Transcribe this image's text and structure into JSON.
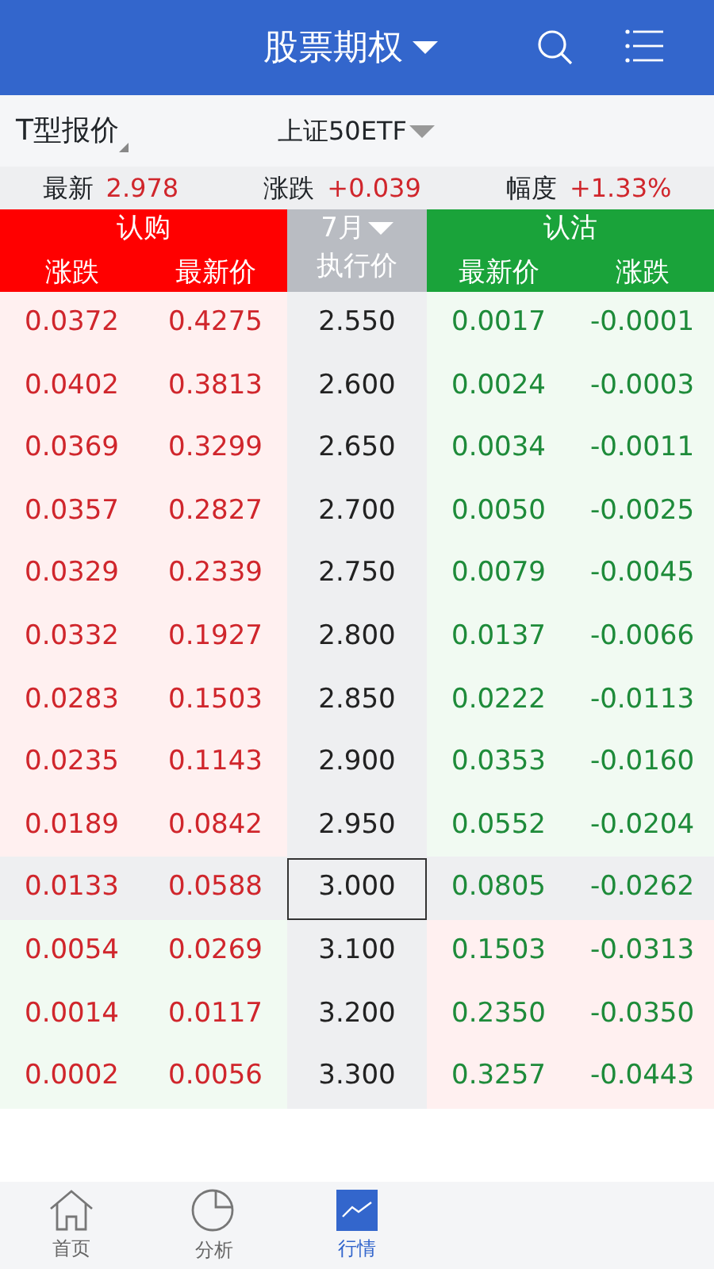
{
  "header": {
    "title": "股票期权"
  },
  "subheader": {
    "view": "T型报价",
    "underlying": "上证50ETF"
  },
  "quote": [
    {
      "label": "最新",
      "value": "2.978"
    },
    {
      "label": "涨跌",
      "value": "+0.039"
    },
    {
      "label": "幅度",
      "value": "+1.33%"
    }
  ],
  "table": {
    "call_title": "认购",
    "put_title": "认沽",
    "month": "7月",
    "call_columns": [
      "涨跌",
      "最新价"
    ],
    "strike_column": "执行价",
    "put_columns": [
      "最新价",
      "涨跌"
    ],
    "rows": [
      {
        "kind": "call_itm",
        "selected": false,
        "call_change": "0.0372",
        "call_price": "0.4275",
        "strike": "2.550",
        "put_price": "0.0017",
        "put_change": "-0.0001"
      },
      {
        "kind": "call_itm",
        "selected": false,
        "call_change": "0.0402",
        "call_price": "0.3813",
        "strike": "2.600",
        "put_price": "0.0024",
        "put_change": "-0.0003"
      },
      {
        "kind": "call_itm",
        "selected": false,
        "call_change": "0.0369",
        "call_price": "0.3299",
        "strike": "2.650",
        "put_price": "0.0034",
        "put_change": "-0.0011"
      },
      {
        "kind": "call_itm",
        "selected": false,
        "call_change": "0.0357",
        "call_price": "0.2827",
        "strike": "2.700",
        "put_price": "0.0050",
        "put_change": "-0.0025"
      },
      {
        "kind": "call_itm",
        "selected": false,
        "call_change": "0.0329",
        "call_price": "0.2339",
        "strike": "2.750",
        "put_price": "0.0079",
        "put_change": "-0.0045"
      },
      {
        "kind": "call_itm",
        "selected": false,
        "call_change": "0.0332",
        "call_price": "0.1927",
        "strike": "2.800",
        "put_price": "0.0137",
        "put_change": "-0.0066"
      },
      {
        "kind": "call_itm",
        "selected": false,
        "call_change": "0.0283",
        "call_price": "0.1503",
        "strike": "2.850",
        "put_price": "0.0222",
        "put_change": "-0.0113"
      },
      {
        "kind": "call_itm",
        "selected": false,
        "call_change": "0.0235",
        "call_price": "0.1143",
        "strike": "2.900",
        "put_price": "0.0353",
        "put_change": "-0.0160"
      },
      {
        "kind": "call_itm",
        "selected": false,
        "call_change": "0.0189",
        "call_price": "0.0842",
        "strike": "2.950",
        "put_price": "0.0552",
        "put_change": "-0.0204"
      },
      {
        "kind": "atm",
        "selected": true,
        "call_change": "0.0133",
        "call_price": "0.0588",
        "strike": "3.000",
        "put_price": "0.0805",
        "put_change": "-0.0262"
      },
      {
        "kind": "put_itm",
        "selected": false,
        "call_change": "0.0054",
        "call_price": "0.0269",
        "strike": "3.100",
        "put_price": "0.1503",
        "put_change": "-0.0313"
      },
      {
        "kind": "put_itm",
        "selected": false,
        "call_change": "0.0014",
        "call_price": "0.0117",
        "strike": "3.200",
        "put_price": "0.2350",
        "put_change": "-0.0350"
      },
      {
        "kind": "put_itm",
        "selected": false,
        "call_change": "0.0002",
        "call_price": "0.0056",
        "strike": "3.300",
        "put_price": "0.3257",
        "put_change": "-0.0443"
      }
    ]
  },
  "tabbar": [
    {
      "kind": "home",
      "label": "首页",
      "selected": false
    },
    {
      "kind": "pie",
      "label": "分析",
      "selected": false
    },
    {
      "kind": "chart",
      "label": "行情",
      "selected": true
    }
  ]
}
